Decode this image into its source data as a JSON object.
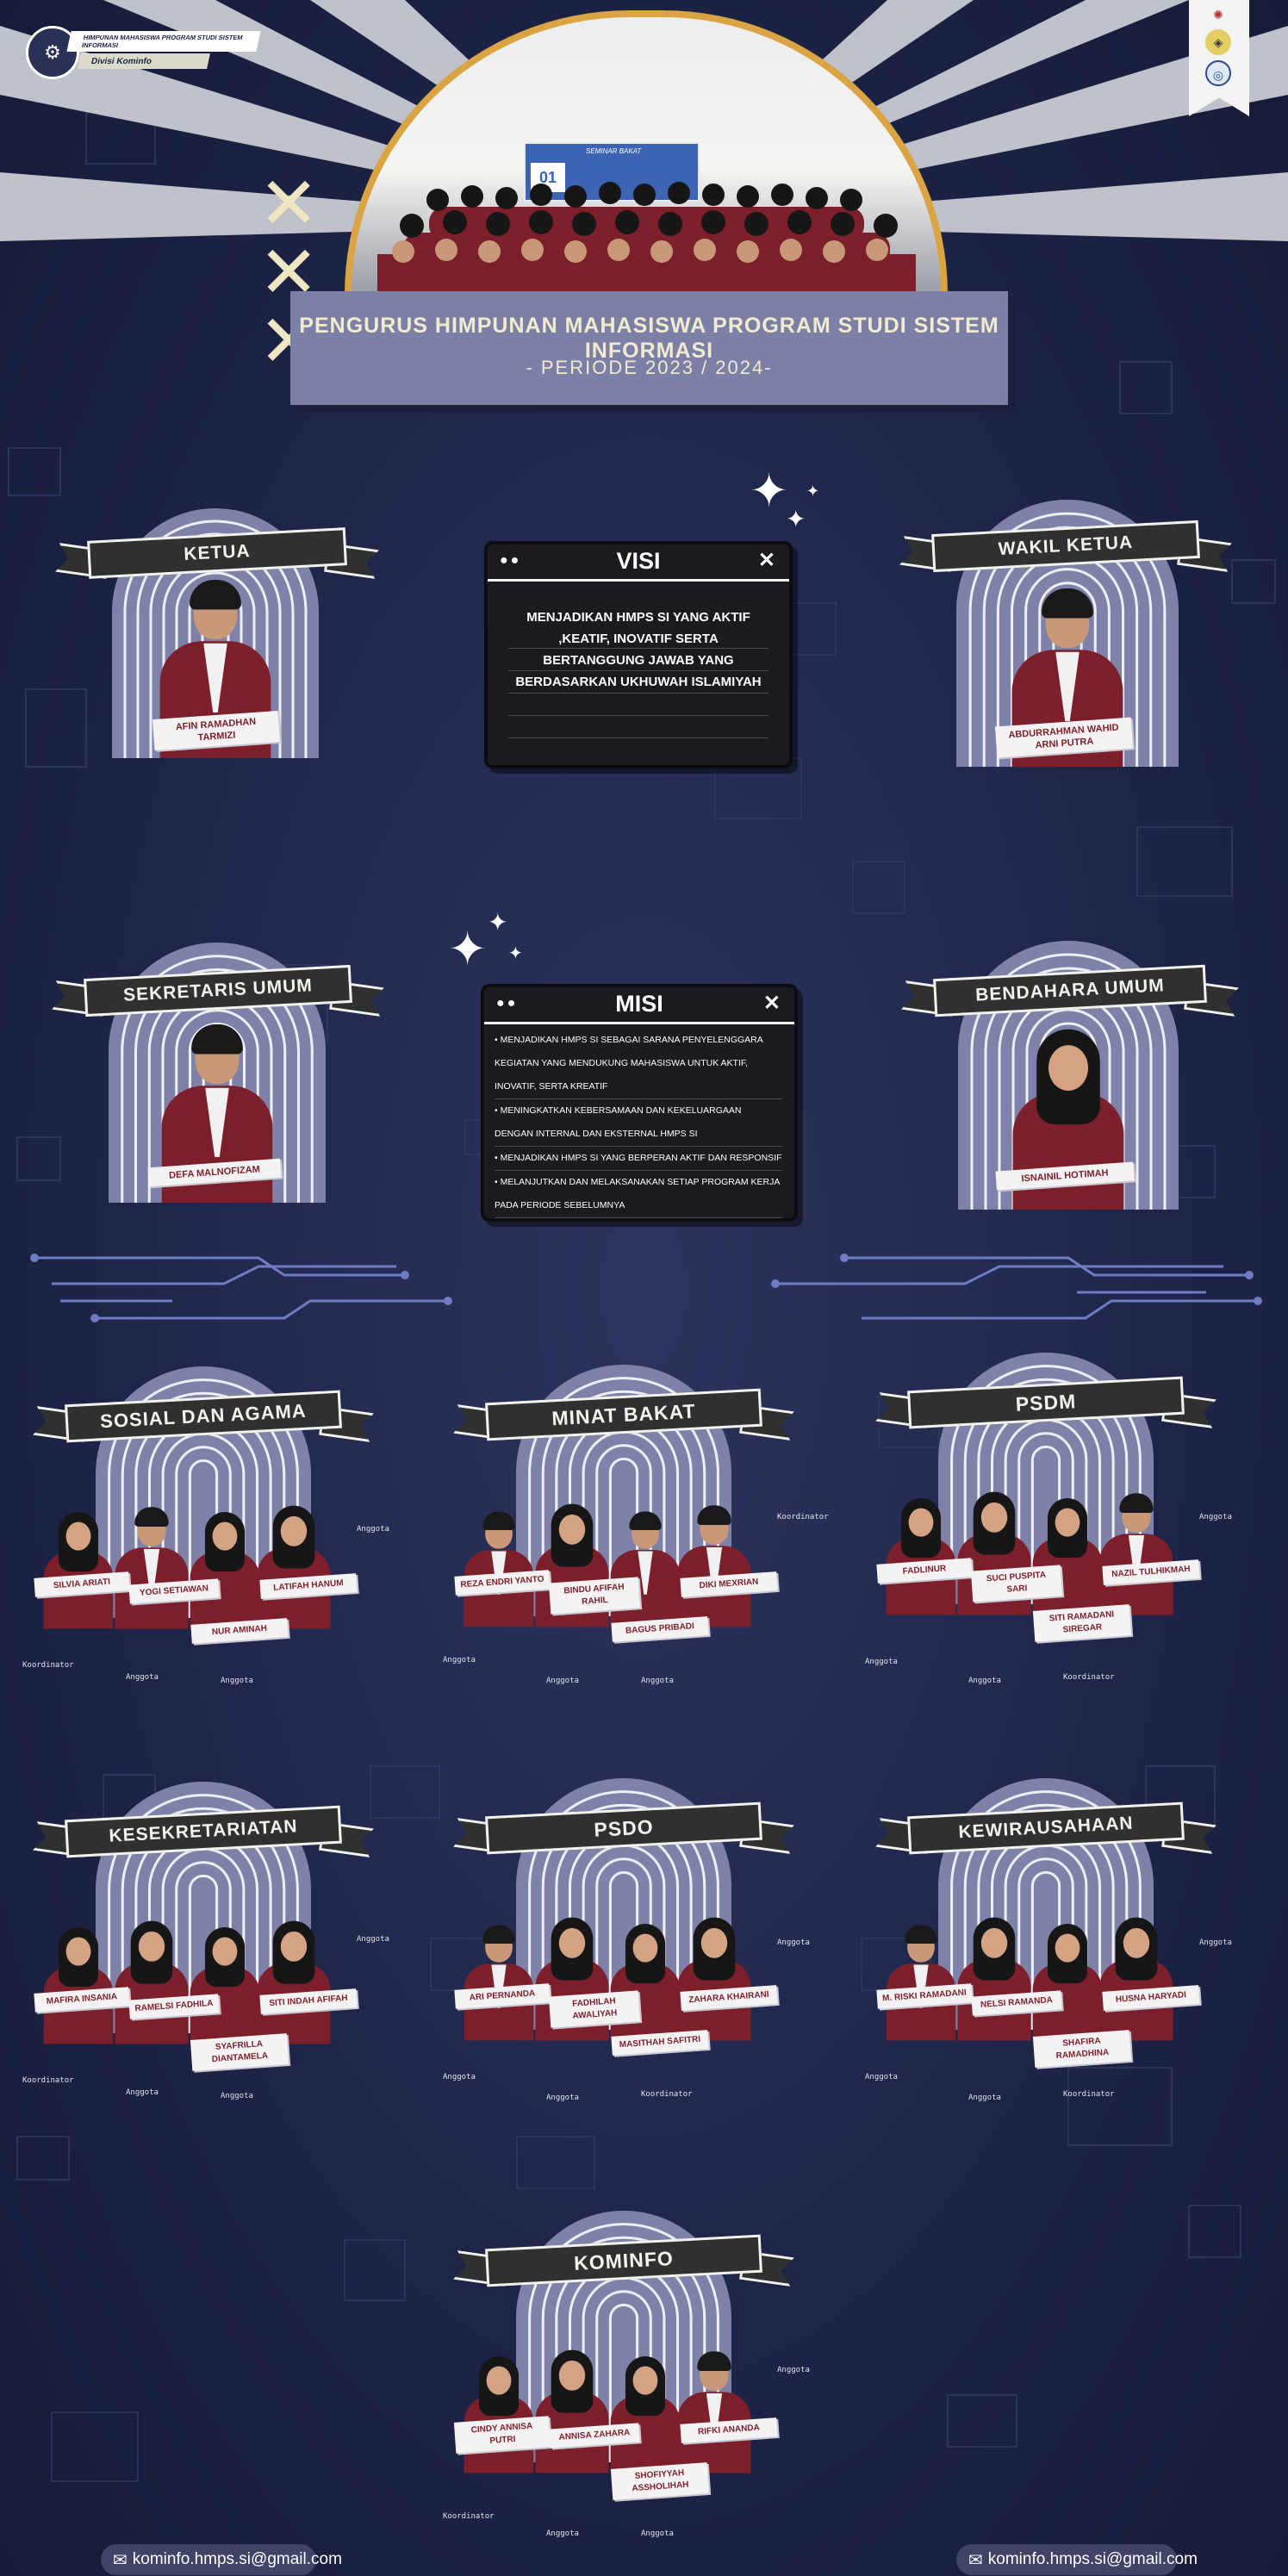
{
  "header": {
    "org_title": "HIMPUNAN MAHASISWA PROGRAM STUDI SISTEM INFORMASI",
    "division": "Divisi Kominfo",
    "main_title": "PENGURUS HIMPUNAN MAHASISWA PROGRAM STUDI SISTEM INFORMASI",
    "period": "- PERIODE 2023 / 2024-",
    "banner_text": "SEMINAR BAKAT"
  },
  "visi": {
    "title": "VISI",
    "text": "MENJADIKAN HMPS SI YANG AKTIF ,KEATIF, INOVATIF SERTA BERTANGGUNG JAWAB YANG BERDASARKAN UKHUWAH ISLAMIYAH"
  },
  "misi": {
    "title": "MISI",
    "items": [
      "• MENJADIKAN HMPS SI SEBAGAI SARANA PENYELENGGARA KEGIATAN YANG MENDUKUNG MAHASISWA UNTUK AKTIF, INOVATIF, SERTA KREATIF",
      "• MENINGKATKAN KEBERSAMAAN DAN KEKELUARGAAN DENGAN INTERNAL DAN EKSTERNAL HMPS SI",
      "• MENJADIKAN HMPS SI YANG BERPERAN AKTIF DAN RESPONSIF",
      "• MELANJUTKAN DAN MELAKSANAKAN SETIAP PROGRAM KERJA PADA PERIODE SEBELUMNYA"
    ]
  },
  "leaders": [
    {
      "role": "KETUA",
      "name": "AFIN RAMADHAN TARMIZI"
    },
    {
      "role": "WAKIL KETUA",
      "name": "ABDURRAHMAN WAHID ARNI PUTRA"
    },
    {
      "role": "SEKRETARIS UMUM",
      "name": "DEFA MALNOFIZAM"
    },
    {
      "role": "BENDAHARA UMUM",
      "name": "ISNAINIL HOTIMAH"
    }
  ],
  "divisions": [
    {
      "title": "SOSIAL DAN AGAMA",
      "members": [
        "SILVIA ARIATI",
        "YOGI SETIAWAN",
        "NUR AMINAH",
        "LATIFAH HANUM"
      ],
      "roles": [
        "Koordinator",
        "Anggota",
        "Anggota",
        "Anggota"
      ]
    },
    {
      "title": "MINAT BAKAT",
      "members": [
        "REZA ENDRI YANTO",
        "BINDU AFIFAH RAHIL",
        "BAGUS PRIBADI",
        "DIKI MEXRIAN"
      ],
      "roles": [
        "Anggota",
        "Anggota",
        "Anggota",
        "Koordinator"
      ]
    },
    {
      "title": "PSDM",
      "members": [
        "FADLINUR",
        "SUCI PUSPITA SARI",
        "SITI RAMADANI SIREGAR",
        "NAZIL TULHIKMAH"
      ],
      "roles": [
        "Anggota",
        "Anggota",
        "Koordinator",
        "Anggota"
      ]
    },
    {
      "title": "KESEKRETARIATAN",
      "members": [
        "MAFIRA INSANIA",
        "RAMELSI FADHILA",
        "SYAFRILLA DIANTAMELA",
        "SITI INDAH AFIFAH"
      ],
      "roles": [
        "Koordinator",
        "Anggota",
        "Anggota",
        "Anggota"
      ]
    },
    {
      "title": "PSDO",
      "members": [
        "ARI PERNANDA",
        "FADHILAH AWALIYAH",
        "MASITHAH SAFITRI",
        "ZAHARA KHAIRANI"
      ],
      "roles": [
        "Anggota",
        "Anggota",
        "Koordinator",
        "Anggota"
      ]
    },
    {
      "title": "KEWIRAUSAHAAN",
      "members": [
        "M. RISKI RAMADANI",
        "NELSI RAMANDA",
        "SHAFIRA RAMADHINA",
        "HUSNA HARYADI"
      ],
      "roles": [
        "Anggota",
        "Anggota",
        "Koordinator",
        "Anggota"
      ]
    },
    {
      "title": "KOMINFO",
      "members": [
        "CINDY ANNISA PUTRI",
        "ANNISA ZAHARA",
        "SHOFIYYAH ASSHOLIHAH",
        "RIFKI ANANDA"
      ],
      "roles": [
        "Koordinator",
        "Anggota",
        "Anggota",
        "Anggota"
      ]
    }
  ],
  "footer": {
    "email_left": "kominfo.hmps.si@gmail.com",
    "email_right": "kominfo.hmps.si@gmail.com"
  },
  "icons": [
    "logo-icon",
    "ribbon-emblem-icon",
    "envelope-icon",
    "sparkle-icon",
    "close-icon",
    "x-mark-icon"
  ],
  "colors": {
    "background": "#1d2447",
    "maroon": "#7c1f2b",
    "arch": "#7e82a8",
    "gold": "#d9a441",
    "cream": "#f1eccf"
  }
}
